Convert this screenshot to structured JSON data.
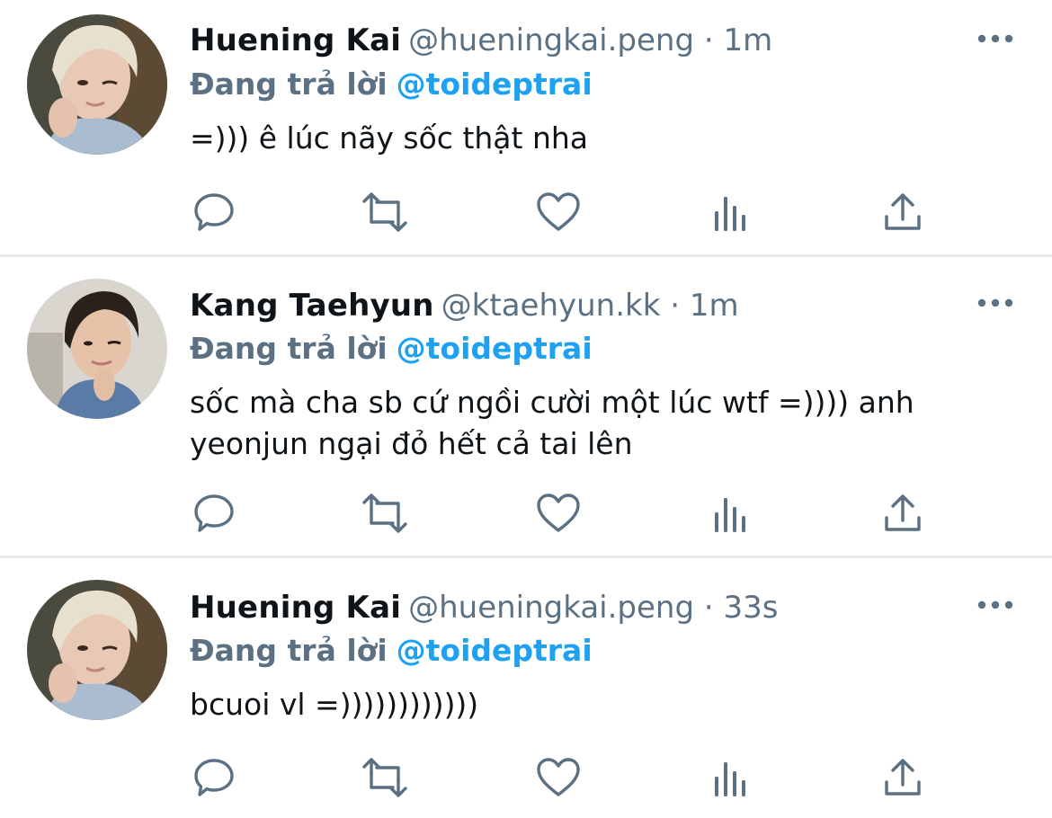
{
  "colors": {
    "text_primary": "#0f1419",
    "text_secondary": "#5b7083",
    "accent": "#1da1f2",
    "icon": "#5b7083",
    "divider": "#e6e9eb"
  },
  "icons": {
    "reply": "comment-icon",
    "retweet": "retweet-icon",
    "like": "heart-icon",
    "analytics": "analytics-icon",
    "share": "share-icon",
    "more": "more-icon"
  },
  "tweets": [
    {
      "name": "Huening Kai",
      "handle": "@hueningkai.peng",
      "separator": "·",
      "time": "1m",
      "reply_prefix": "Đang trả lời",
      "reply_to": "@toideptrai",
      "text": "=))) ê lúc nãy sốc thật nha"
    },
    {
      "name": "Kang Taehyun",
      "handle": "@ktaehyun.kk",
      "separator": "·",
      "time": "1m",
      "reply_prefix": "Đang trả lời",
      "reply_to": "@toideptrai",
      "text": "sốc mà cha sb cứ ngồi cười một lúc wtf =)))) anh yeonjun ngại đỏ hết cả tai lên"
    },
    {
      "name": "Huening Kai",
      "handle": "@hueningkai.peng",
      "separator": "·",
      "time": "33s",
      "reply_prefix": "Đang trả lời",
      "reply_to": "@toideptrai",
      "text": "bcuoi vl =))))))))))))"
    }
  ]
}
